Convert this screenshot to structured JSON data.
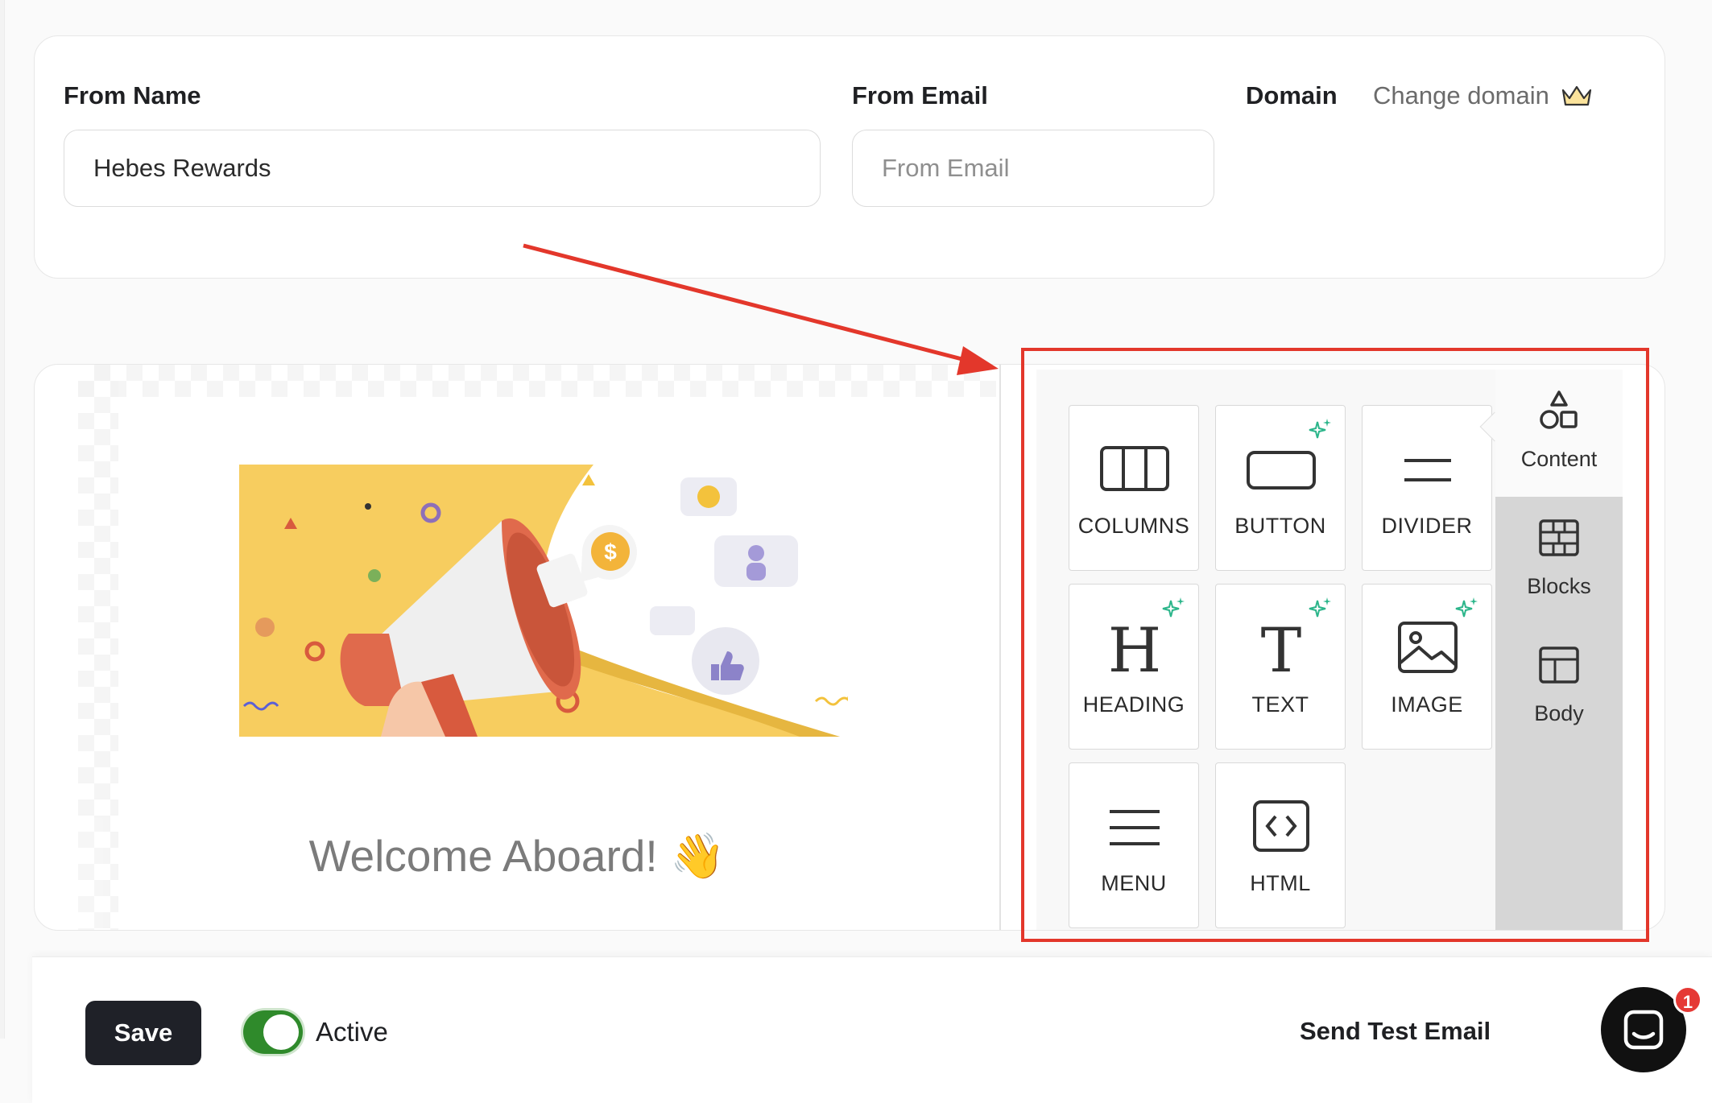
{
  "sender": {
    "from_name_label": "From Name",
    "from_name_value": "Hebes Rewards",
    "from_email_label": "From Email",
    "from_email_placeholder": "From Email",
    "domain_label": "Domain",
    "change_domain_label": "Change domain",
    "change_domain_icon": "crown-icon"
  },
  "canvas": {
    "welcome_text": "Welcome Aboard! 👋",
    "hero_image": "megaphone-illustration"
  },
  "content_tools": [
    {
      "label": "COLUMNS",
      "icon": "columns-icon",
      "sparkle": false
    },
    {
      "label": "BUTTON",
      "icon": "button-icon",
      "sparkle": true
    },
    {
      "label": "DIVIDER",
      "icon": "divider-icon",
      "sparkle": false
    },
    {
      "label": "HEADING",
      "icon": "heading-icon",
      "sparkle": true
    },
    {
      "label": "TEXT",
      "icon": "text-icon",
      "sparkle": true
    },
    {
      "label": "IMAGE",
      "icon": "image-icon",
      "sparkle": true
    },
    {
      "label": "MENU",
      "icon": "menu-icon",
      "sparkle": false
    },
    {
      "label": "HTML",
      "icon": "html-icon",
      "sparkle": false
    }
  ],
  "side_tabs": [
    {
      "label": "Content",
      "icon": "shapes-icon",
      "active": true
    },
    {
      "label": "Blocks",
      "icon": "blocks-icon",
      "active": false
    },
    {
      "label": "Body",
      "icon": "body-layout-icon",
      "active": false
    }
  ],
  "footer": {
    "save_label": "Save",
    "active_label": "Active",
    "active_on": true,
    "send_test_label": "Send Test Email"
  },
  "chat": {
    "badge_count": "1"
  },
  "colors": {
    "highlight": "#e3372b",
    "toggle_on": "#2f8a2b",
    "save_button": "#1f2128",
    "sparkle": "#2bb58a",
    "hero_yellow": "#f7cd5f"
  }
}
